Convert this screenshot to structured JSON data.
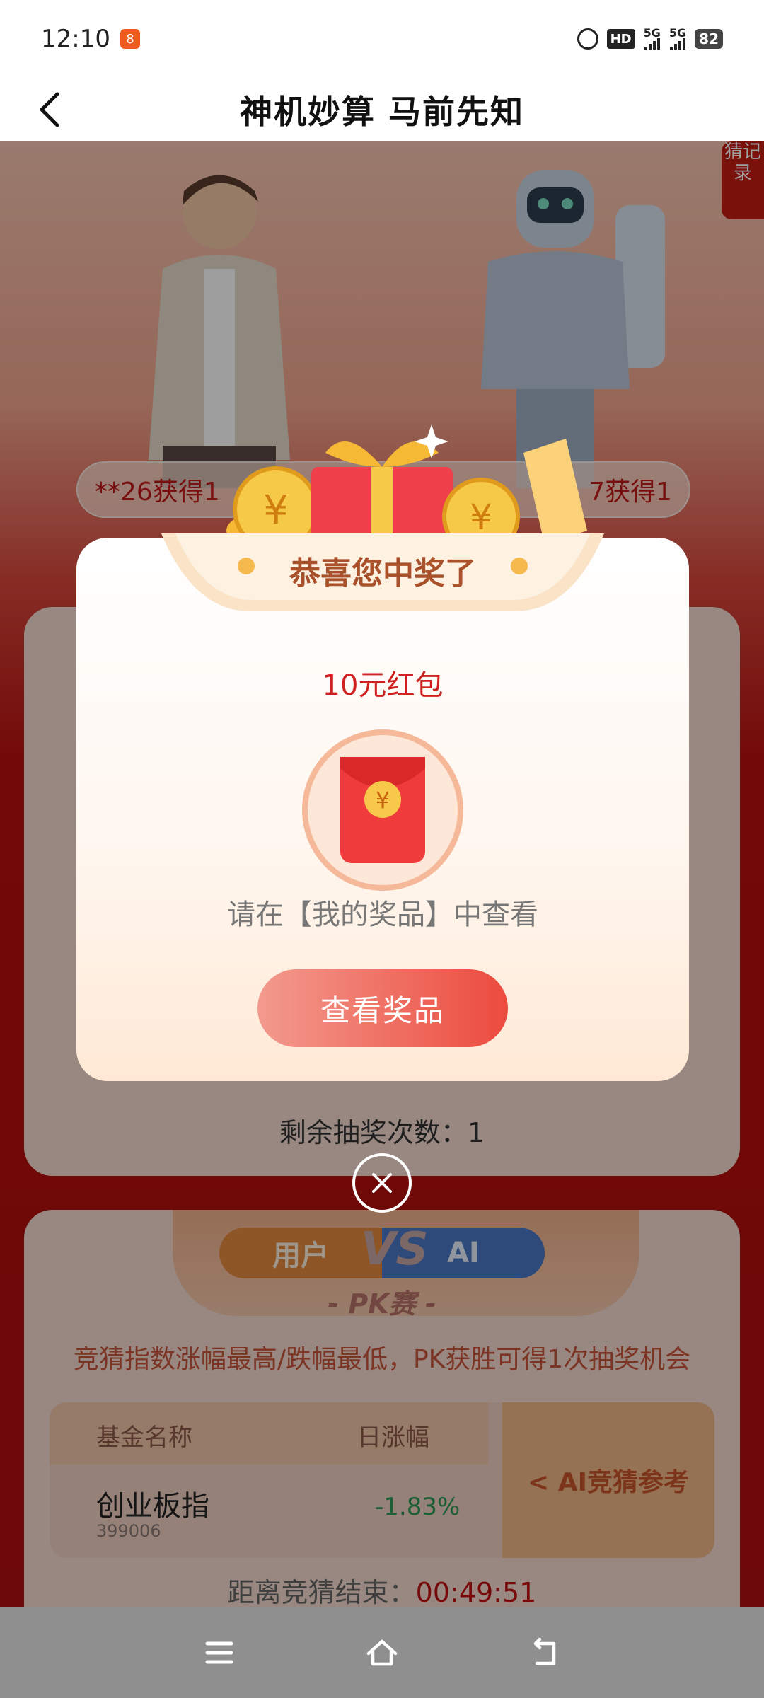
{
  "status_bar": {
    "time": "12:10",
    "app_badge": "8",
    "hd_label": "HD",
    "network_1": "5G",
    "network_2": "5G",
    "battery": "82"
  },
  "header": {
    "title": "神机妙算  马前先知",
    "back_icon": "chevron-left-icon"
  },
  "background_page": {
    "side_tab_label": "猜记录",
    "ticker_left": "**26",
    "ticker_left_suffix": "获得1",
    "ticker_right": "7获得1",
    "remaining_label": "剩余抽奖次数：",
    "remaining_count": "1",
    "pk": {
      "user_label": "用户",
      "vs_label": "VS",
      "ai_label": "AI",
      "title": "- PK赛 -",
      "description": "竞猜指数涨幅最高/跌幅最低，PK获胜可得1次抽奖机会",
      "col_fund_name": "基金名称",
      "col_daily_change": "日涨幅",
      "fund_name": "创业板指",
      "fund_code": "399006",
      "fund_change": "-1.83%",
      "ai_reference": "< AI竞猜参考"
    },
    "countdown_label": "距离竞猜结束：",
    "countdown_time": "00:49:51"
  },
  "modal": {
    "title": "恭喜您中奖了",
    "prize_name": "10元红包",
    "hint": "请在【我的奖品】中查看",
    "view_button": "查看奖品",
    "close_icon": "close-icon"
  },
  "nav_bar": {
    "menu_icon": "menu-icon",
    "home_icon": "home-icon",
    "back_icon": "back-icon"
  },
  "colors": {
    "accent_red": "#d01f1f",
    "button_gradient_start": "#f39a8e",
    "button_gradient_end": "#ec4b3e",
    "fund_change_green": "#2e9a5a"
  }
}
